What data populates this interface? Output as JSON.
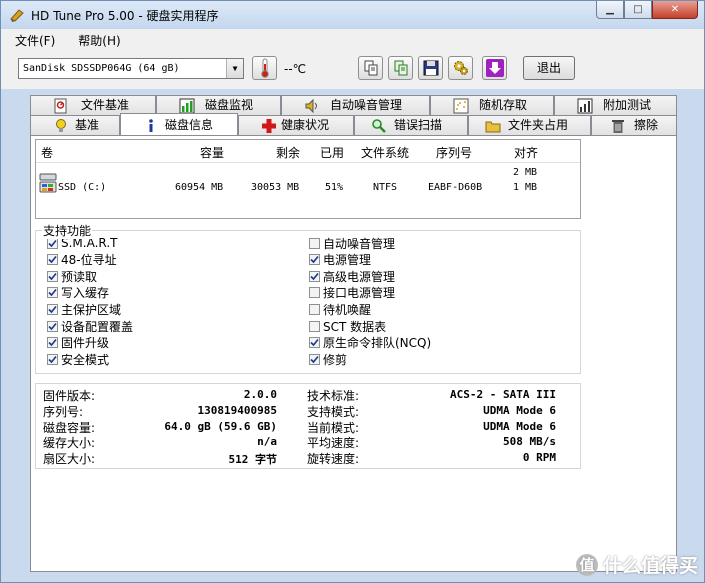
{
  "window": {
    "title": "HD Tune Pro 5.00 - 硬盘实用程序"
  },
  "menu": [
    {
      "label": "文件(F)"
    },
    {
      "label": "帮助(H)"
    }
  ],
  "toolbar": {
    "drive": "SanDisk SDSSDP064G (64 gB)",
    "temperature": "--℃",
    "exit_label": "退出"
  },
  "tabs_top": [
    {
      "label": "文件基准",
      "icon": "file-benchmark-icon"
    },
    {
      "label": "磁盘监视",
      "icon": "disk-monitor-icon"
    },
    {
      "label": "自动噪音管理",
      "icon": "speaker-icon"
    },
    {
      "label": "随机存取",
      "icon": "random-access-icon"
    },
    {
      "label": "附加测试",
      "icon": "extra-tests-icon"
    }
  ],
  "tabs_bottom": [
    {
      "label": "基准",
      "icon": "lightbulb-icon"
    },
    {
      "label": "磁盘信息",
      "icon": "info-icon",
      "active": true
    },
    {
      "label": "健康状况",
      "icon": "health-cross-icon"
    },
    {
      "label": "错误扫描",
      "icon": "magnifier-icon"
    },
    {
      "label": "文件夹占用",
      "icon": "folder-icon"
    },
    {
      "label": "擦除",
      "icon": "trash-icon"
    }
  ],
  "volumes": {
    "headers": [
      "卷",
      "容量",
      "剩余",
      "已用",
      "文件系统",
      "序列号",
      "对齐"
    ],
    "pre_row_align": "2 MB",
    "rows": [
      {
        "name": "SSD (C:)",
        "capacity": "60954 MB",
        "free": "30053 MB",
        "used": "51%",
        "fs": "NTFS",
        "serial": "EABF-D60B",
        "align": "1 MB"
      }
    ]
  },
  "features": {
    "title": "支持功能",
    "left": [
      {
        "label": "S.M.A.R.T",
        "checked": true
      },
      {
        "label": "48-位寻址",
        "checked": true
      },
      {
        "label": "预读取",
        "checked": true
      },
      {
        "label": "写入缓存",
        "checked": true
      },
      {
        "label": "主保护区域",
        "checked": true
      },
      {
        "label": "设备配置覆盖",
        "checked": true
      },
      {
        "label": "固件升级",
        "checked": true
      },
      {
        "label": "安全模式",
        "checked": true
      }
    ],
    "right": [
      {
        "label": "自动噪音管理",
        "checked": false
      },
      {
        "label": "电源管理",
        "checked": true
      },
      {
        "label": "高级电源管理",
        "checked": true
      },
      {
        "label": "接口电源管理",
        "checked": false
      },
      {
        "label": "待机唤醒",
        "checked": false
      },
      {
        "label": "SCT 数据表",
        "checked": false
      },
      {
        "label": "原生命令排队(NCQ)",
        "checked": true
      },
      {
        "label": "修剪",
        "checked": true
      }
    ]
  },
  "info": {
    "left": [
      {
        "label": "固件版本:",
        "value": "2.0.0"
      },
      {
        "label": "序列号:",
        "value": "130819400985"
      },
      {
        "label": "磁盘容量:",
        "value": "64.0 gB (59.6 GB)"
      },
      {
        "label": "缓存大小:",
        "value": "n/a"
      },
      {
        "label": "扇区大小:",
        "value": "512 字节"
      }
    ],
    "right": [
      {
        "label": "技术标准:",
        "value": "ACS-2 - SATA III"
      },
      {
        "label": "支持模式:",
        "value": "UDMA Mode 6"
      },
      {
        "label": "当前模式:",
        "value": "UDMA Mode 6"
      },
      {
        "label": "平均速度:",
        "value": "508 MB/s"
      },
      {
        "label": "旋转速度:",
        "value": "0 RPM"
      }
    ]
  },
  "watermark": {
    "badge": "值",
    "text": "什么值得买"
  }
}
